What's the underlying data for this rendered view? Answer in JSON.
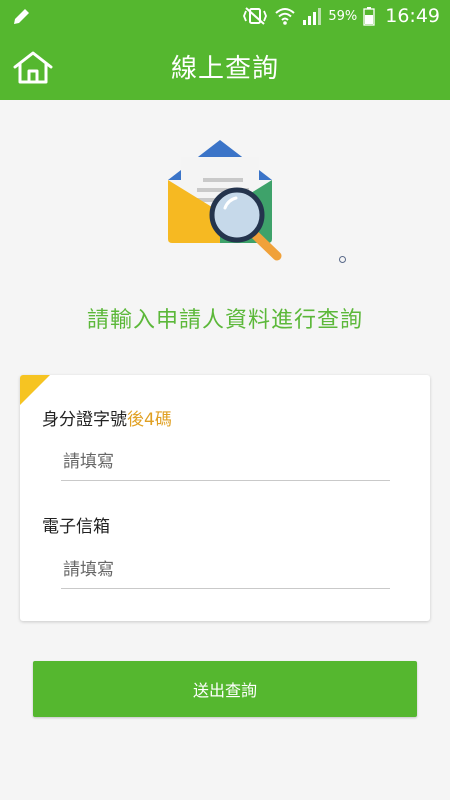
{
  "status_bar": {
    "battery_percent": "59%",
    "time": "16:49",
    "icons": [
      "pencil-icon",
      "vibrate-icon",
      "wifi-icon",
      "signal-icon",
      "battery-icon"
    ]
  },
  "app_bar": {
    "title": "線上查詢",
    "home_icon": "home-icon",
    "color": "#55b72f"
  },
  "illustration": {
    "icon": "envelope-search-icon"
  },
  "prompt": "請輸入申請人資料進行查詢",
  "form": {
    "id_label_main": "身分證字號",
    "id_label_accent": "後4碼",
    "id_placeholder": "請填寫",
    "email_label": "電子信箱",
    "email_placeholder": "請填寫",
    "accent_color": "#e0a023"
  },
  "submit_label": "送出查詢"
}
